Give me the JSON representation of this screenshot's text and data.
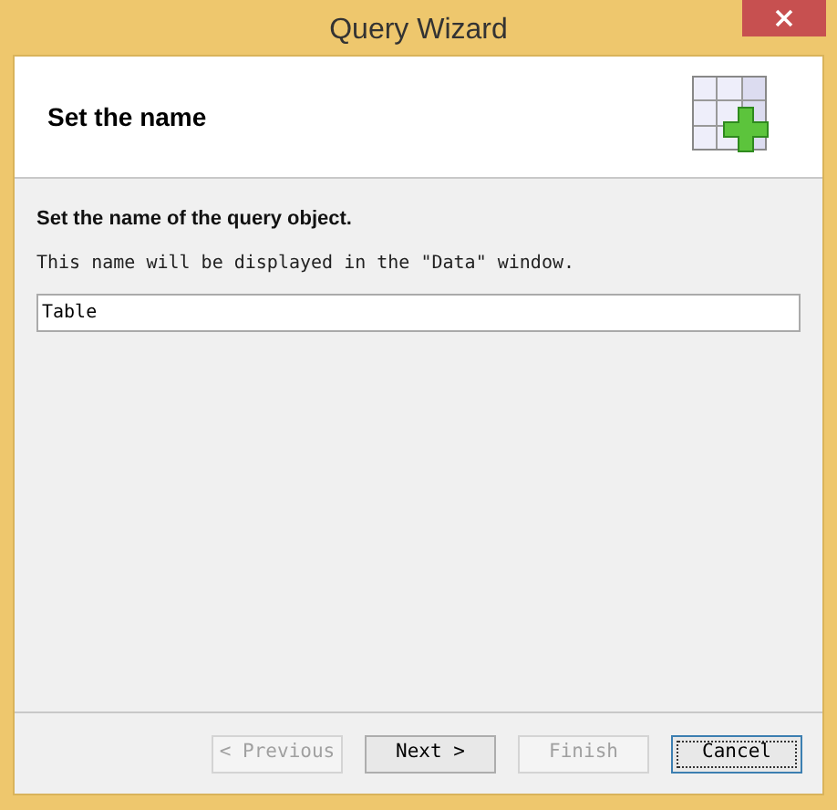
{
  "window": {
    "title": "Query Wizard"
  },
  "header": {
    "title": "Set the name"
  },
  "body": {
    "heading": "Set the name of the query object.",
    "description": "This name will be displayed in the \"Data\" window.",
    "name_field": {
      "value": "Table"
    }
  },
  "buttons": [
    {
      "label": "< Previous",
      "disabled": true,
      "focused": false
    },
    {
      "label": "Next >",
      "disabled": false,
      "focused": false
    },
    {
      "label": "Finish",
      "disabled": true,
      "focused": false
    },
    {
      "label": "Cancel",
      "disabled": false,
      "focused": true
    }
  ]
}
